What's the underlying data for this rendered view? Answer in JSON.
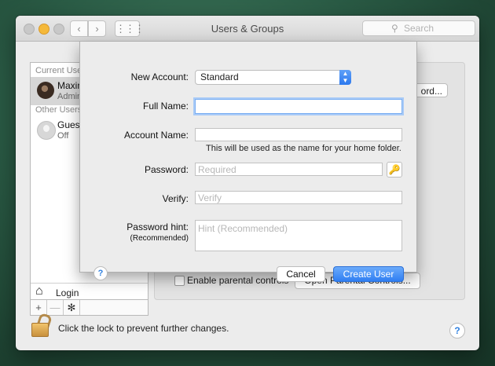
{
  "window": {
    "title": "Users & Groups",
    "search_placeholder": "Search",
    "nav_back": "‹",
    "nav_forward": "›",
    "grid_glyph": "⋮⋮⋮"
  },
  "sidebar": {
    "current_users_heading": "Current Use",
    "other_users_heading": "Other Users",
    "users": [
      {
        "name": "Maxin",
        "role": "Admin",
        "selected": true
      },
      {
        "name": "Gues",
        "role": "Off",
        "selected": false
      }
    ],
    "login_label": "Login",
    "add_glyph": "+",
    "remove_glyph": "—",
    "gear_glyph": "✻"
  },
  "main": {
    "password_button": "ord...",
    "parental_label": "Enable parental controls",
    "parental_button": "Open Parental Controls..."
  },
  "footer": {
    "lock_text": "Click the lock to prevent further changes.",
    "help_glyph": "?"
  },
  "sheet": {
    "new_account_label": "New Account:",
    "new_account_value": "Standard",
    "popup_arrows": "▲▼",
    "full_name_label": "Full Name:",
    "full_name_value": "",
    "account_name_label": "Account Name:",
    "account_name_value": "",
    "account_name_note": "This will be used as the name for your home folder.",
    "password_label": "Password:",
    "password_placeholder": "Required",
    "key_glyph": "🔑",
    "verify_label": "Verify:",
    "verify_placeholder": "Verify",
    "hint_label": "Password hint:",
    "hint_sublabel": "(Recommended)",
    "hint_placeholder": "Hint (Recommended)",
    "help_glyph": "?",
    "cancel_label": "Cancel",
    "create_label": "Create User",
    "accent_color": "#2f7ef2"
  }
}
